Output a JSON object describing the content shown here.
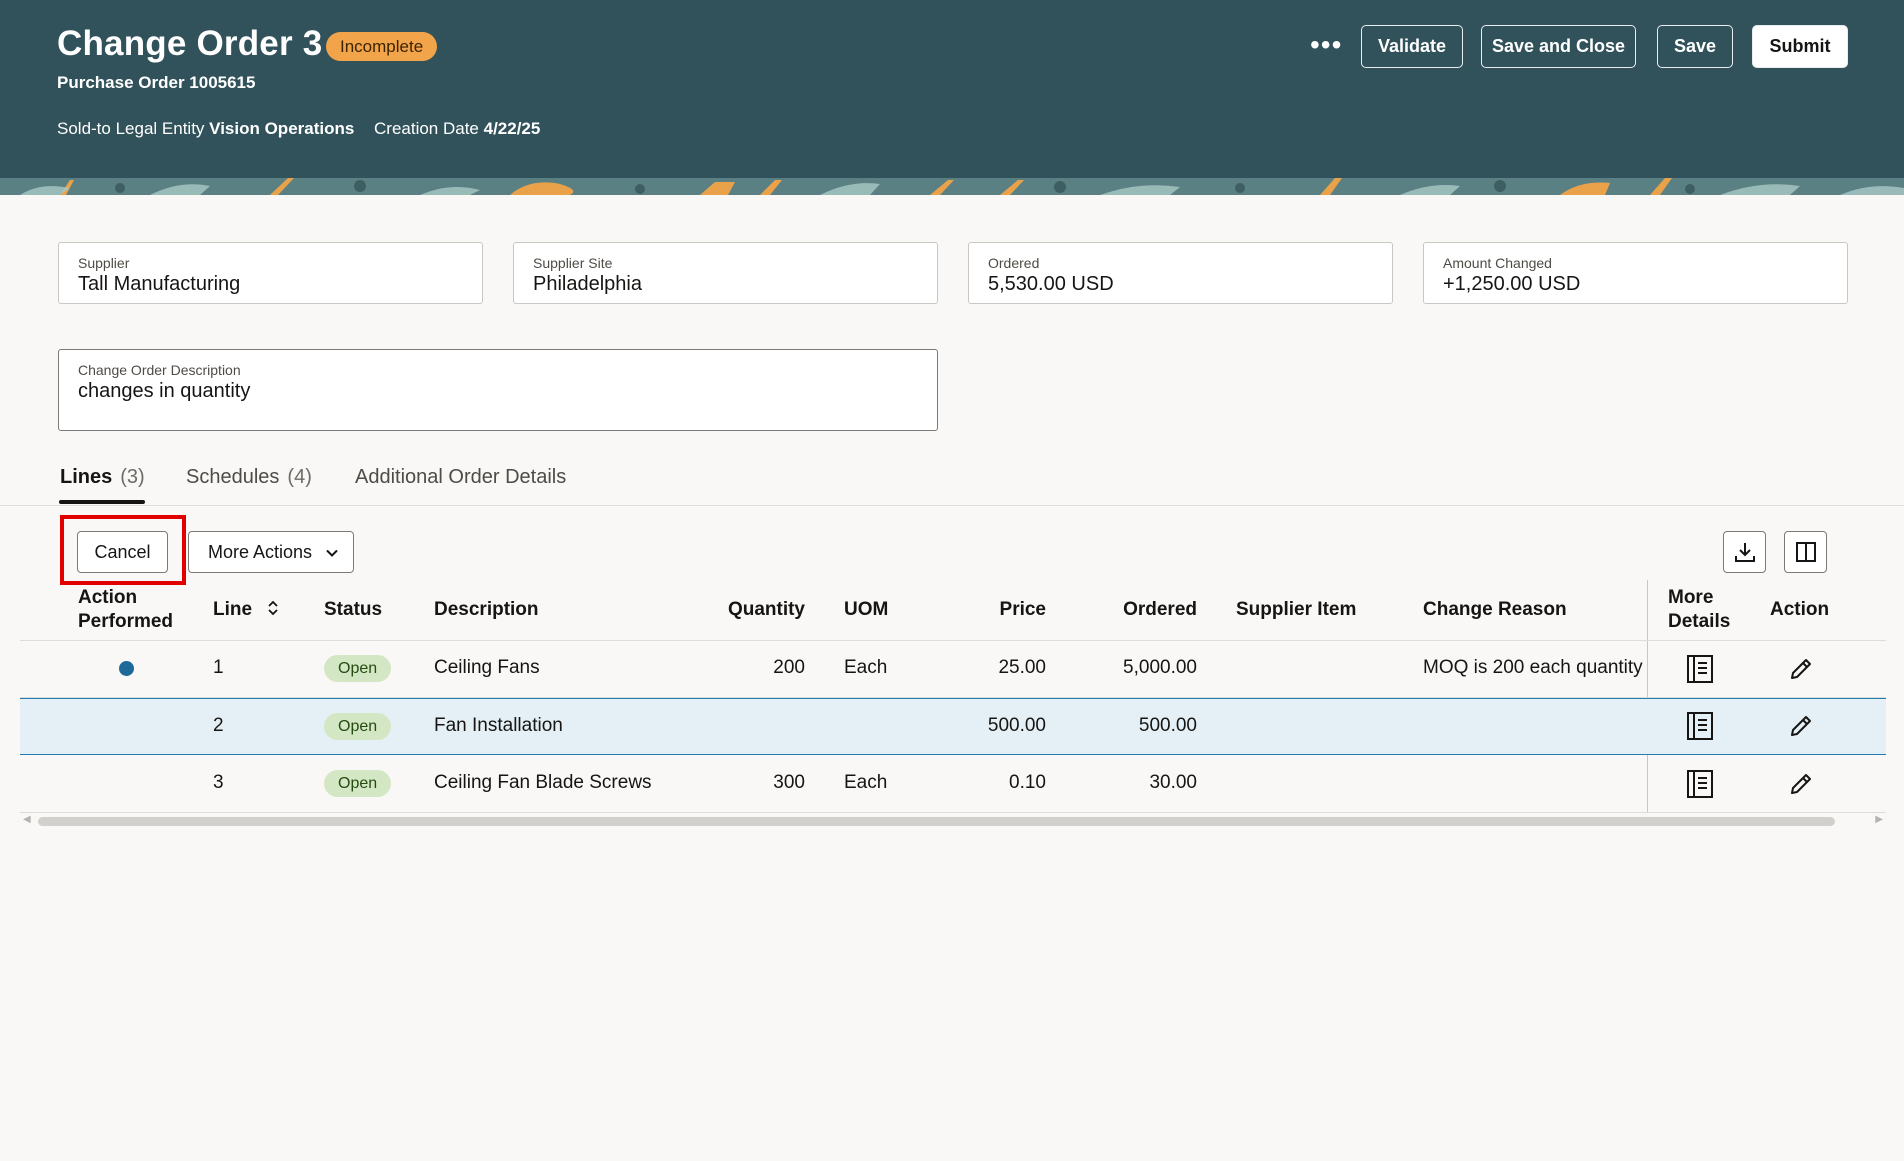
{
  "header": {
    "title": "Change Order 3",
    "status_badge": "Incomplete",
    "subtitle": "Purchase Order 1005615",
    "sold_to_label": "Sold-to Legal Entity",
    "sold_to_value": "Vision Operations",
    "creation_date_label": "Creation Date",
    "creation_date_value": "4/22/25",
    "more_label": "•••",
    "buttons": {
      "validate": "Validate",
      "save_and_close": "Save and Close",
      "save": "Save",
      "submit": "Submit"
    }
  },
  "info": {
    "supplier_label": "Supplier",
    "supplier_value": "Tall Manufacturing",
    "site_label": "Supplier Site",
    "site_value": "Philadelphia",
    "ordered_label": "Ordered",
    "ordered_value": "5,530.00 USD",
    "amount_changed_label": "Amount Changed",
    "amount_changed_value": "+1,250.00 USD",
    "description_label": "Change Order Description",
    "description_value": "changes in quantity"
  },
  "tabs": [
    {
      "label": "Lines",
      "count": "(3)",
      "active": true
    },
    {
      "label": "Schedules",
      "count": "(4)",
      "active": false
    },
    {
      "label": "Additional Order Details",
      "count": "",
      "active": false
    }
  ],
  "toolbar": {
    "cancel_label": "Cancel",
    "more_actions_label": "More Actions",
    "download_icon": "download-icon",
    "columns_icon": "columns-icon"
  },
  "table": {
    "headers": {
      "action_performed_1": "Action",
      "action_performed_2": "Performed",
      "line": "Line",
      "status": "Status",
      "description": "Description",
      "quantity": "Quantity",
      "uom": "UOM",
      "price": "Price",
      "ordered": "Ordered",
      "supplier_item": "Supplier Item",
      "change_reason": "Change Reason",
      "more_details_1": "More",
      "more_details_2": "Details",
      "action": "Action"
    },
    "rows": [
      {
        "action_performed": true,
        "line": "1",
        "status": "Open",
        "description": "Ceiling Fans",
        "quantity": "200",
        "uom": "Each",
        "price": "25.00",
        "ordered": "5,000.00",
        "supplier_item": "",
        "change_reason": "MOQ is 200 each quantity"
      },
      {
        "action_performed": false,
        "line": "2",
        "status": "Open",
        "description": "Fan Installation",
        "quantity": "",
        "uom": "",
        "price": "500.00",
        "ordered": "500.00",
        "supplier_item": "",
        "change_reason": ""
      },
      {
        "action_performed": false,
        "line": "3",
        "status": "Open",
        "description": "Ceiling Fan Blade Screws",
        "quantity": "300",
        "uom": "Each",
        "price": "0.10",
        "ordered": "30.00",
        "supplier_item": "",
        "change_reason": ""
      }
    ]
  },
  "colors": {
    "header_bg": "#31525a",
    "badge_bg": "#f1a44a",
    "status_pill_bg": "#d4e7c4",
    "selected_row_bg": "#e4f0f6",
    "highlight_border": "#e10000",
    "action_dot": "#1d6a98"
  }
}
